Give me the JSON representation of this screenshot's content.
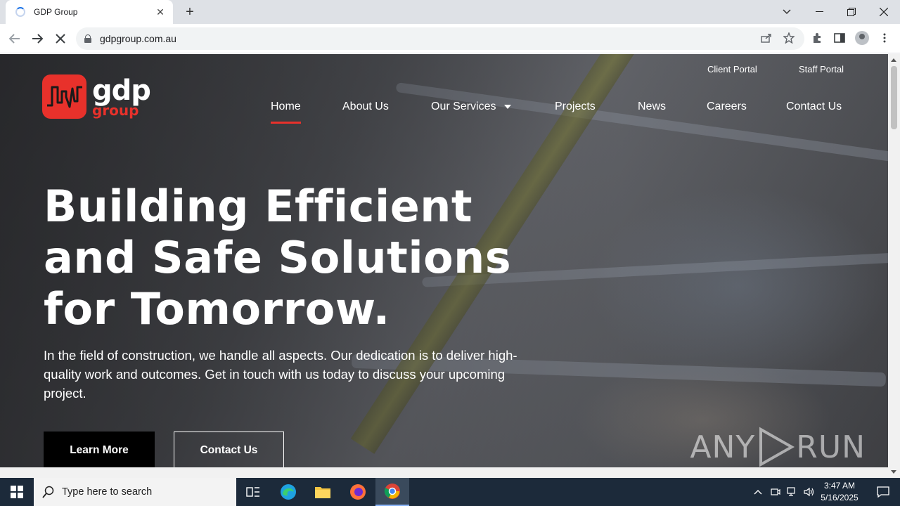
{
  "browser": {
    "tab_title": "GDP Group",
    "url": "gdpgroup.com.au"
  },
  "site": {
    "logo": {
      "word": "gdp",
      "sub": "group",
      "brand_color": "#e8312b"
    },
    "portals": {
      "client": "Client Portal",
      "staff": "Staff Portal"
    },
    "nav": {
      "home": "Home",
      "about": "About Us",
      "services": "Our Services",
      "projects": "Projects",
      "news": "News",
      "careers": "Careers",
      "contact": "Contact Us"
    },
    "hero": {
      "title_line1": "Building Efficient",
      "title_line2": "and Safe Solutions",
      "title_line3": "for Tomorrow.",
      "text": "In the field of construction, we handle all aspects. Our dedication is to deliver high-quality work and outcomes. Get in touch with us today to discuss your upcoming project.",
      "primary_button": "Learn More",
      "secondary_button": "Contact Us"
    },
    "watermark": {
      "left": "ANY",
      "right": "RUN"
    }
  },
  "taskbar": {
    "search_placeholder": "Type here to search",
    "time": "3:47 AM",
    "date": "5/16/2025"
  }
}
